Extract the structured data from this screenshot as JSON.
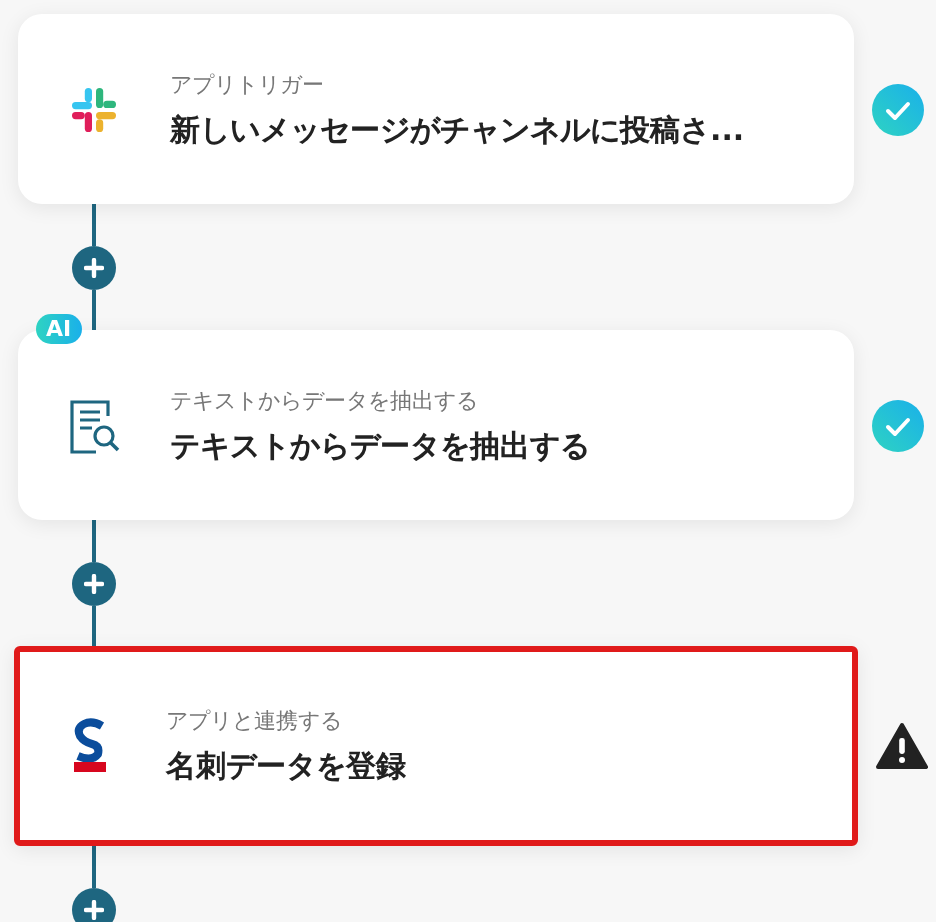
{
  "steps": [
    {
      "kind": "slack",
      "label": "アプリトリガー",
      "title": "新しいメッセージがチャンネルに投稿さ...",
      "done": true,
      "highlighted": false
    },
    {
      "kind": "ai",
      "badge": "AI",
      "label": "テキストからデータを抽出する",
      "title": "テキストからデータを抽出する",
      "done": true,
      "highlighted": false
    },
    {
      "kind": "sansan",
      "label": "アプリと連携する",
      "title": "名刺データを登録",
      "done": false,
      "highlighted": true
    }
  ]
}
